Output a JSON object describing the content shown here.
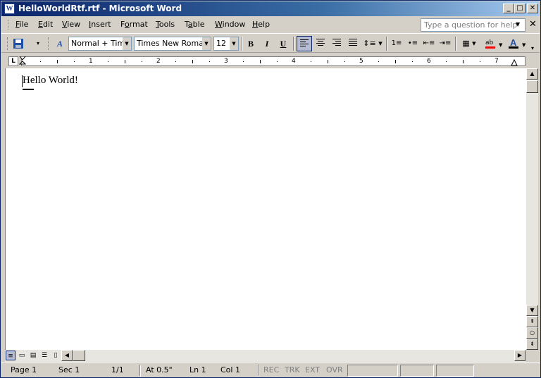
{
  "window": {
    "title": "HelloWorldRtf.rtf - Microsoft Word",
    "app_icon_glyph": "W",
    "minimize_glyph": "_",
    "maximize_glyph": "□",
    "close_glyph": "✕"
  },
  "menu": {
    "items": [
      {
        "label": "File",
        "accel": "F"
      },
      {
        "label": "Edit",
        "accel": "E"
      },
      {
        "label": "View",
        "accel": "V"
      },
      {
        "label": "Insert",
        "accel": "I"
      },
      {
        "label": "Format",
        "accel": "o"
      },
      {
        "label": "Tools",
        "accel": "T"
      },
      {
        "label": "Table",
        "accel": "a"
      },
      {
        "label": "Window",
        "accel": "W"
      },
      {
        "label": "Help",
        "accel": "H"
      }
    ],
    "help_placeholder": "Type a question for help",
    "doc_close_glyph": "✕"
  },
  "toolbar": {
    "style_value": "Normal + Times",
    "font_value": "Times New Roman",
    "size_value": "12",
    "bold_label": "B",
    "italic_label": "I",
    "underline_label": "U",
    "icons": [
      "save-icon",
      "styles-icon",
      "align-left-icon",
      "center-icon",
      "align-right-icon",
      "justify-icon",
      "line-spacing-icon",
      "numbering-icon",
      "bullets-icon",
      "decrease-indent-icon",
      "increase-indent-icon",
      "borders-icon",
      "highlight-icon",
      "font-color-icon"
    ],
    "colors": {
      "highlight": "#ffff00",
      "font_color": "#ff0000",
      "pressed_bg": "#b6bdd2"
    }
  },
  "ruler": {
    "tab_selector": "L",
    "numbers": [
      "1",
      "2",
      "3",
      "4",
      "5",
      "6",
      "7"
    ]
  },
  "document": {
    "text": "Hello World!"
  },
  "status": {
    "page": "Page 1",
    "sec": "Sec 1",
    "pages": "1/1",
    "at": "At 0.5\"",
    "ln": "Ln 1",
    "col": "Col 1",
    "rec": "REC",
    "trk": "TRK",
    "ext": "EXT",
    "ovr": "OVR"
  }
}
